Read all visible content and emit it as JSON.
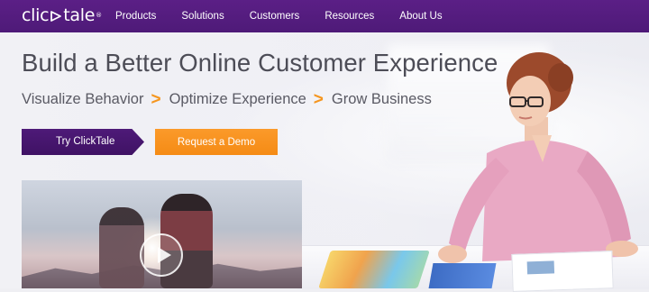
{
  "brand": {
    "logo_text_left": "clic",
    "logo_text_right": "tale",
    "registered": "®"
  },
  "nav": {
    "items": [
      "Products",
      "Solutions",
      "Customers",
      "Resources",
      "About Us"
    ]
  },
  "hero": {
    "headline": "Build a Better Online Customer Experience",
    "tagline": [
      "Visualize Behavior",
      "Optimize Experience",
      "Grow Business"
    ],
    "separator": ">"
  },
  "buttons": {
    "try_label": "Try ClickTale",
    "demo_label": "Request a Demo"
  },
  "colors": {
    "nav_purple": "#5b1f86",
    "button_purple": "#4e1a78",
    "button_orange": "#f7921f",
    "chevron_orange": "#f5961f"
  },
  "icons": {
    "play": "play-icon",
    "logo_mark": "cursor-click-icon"
  }
}
